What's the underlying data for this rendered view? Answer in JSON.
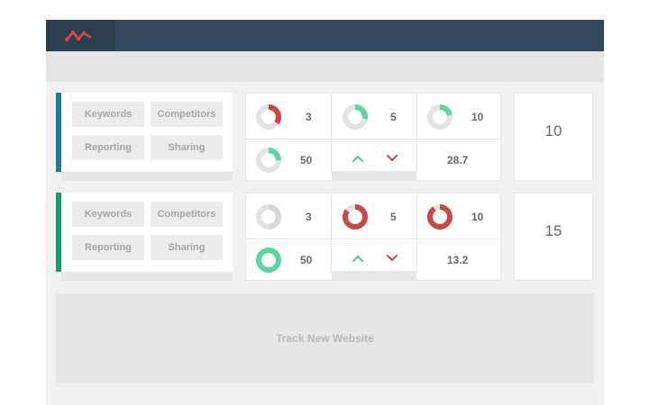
{
  "app": {
    "logo_icon": "trend-line-icon"
  },
  "colors": {
    "topbar": "#34495e",
    "accent_teal": "#1d7e93",
    "accent_green": "#199c6e",
    "donut_red": "#c94a44",
    "donut_green": "#5fd4a0",
    "donut_track": "#e3e3e3"
  },
  "websites": [
    {
      "buttons": [
        "Keywords",
        "Competitors",
        "Reporting",
        "Sharing"
      ],
      "metrics": {
        "m1": {
          "value": "3",
          "color": "#c94a44",
          "fraction": 0.35
        },
        "m2": {
          "value": "5",
          "color": "#5fd4a0",
          "fraction": 0.28
        },
        "m3": {
          "value": "10",
          "color": "#5fd4a0",
          "fraction": 0.22
        },
        "m4": {
          "value": "50",
          "color": "#5fd4a0",
          "fraction": 0.25
        },
        "up_icon": "chevron-up-icon",
        "down_icon": "chevron-down-icon",
        "average": "28.7"
      },
      "total": "10"
    },
    {
      "buttons": [
        "Keywords",
        "Competitors",
        "Reporting",
        "Sharing"
      ],
      "metrics": {
        "m1": {
          "value": "3",
          "color": "#d6d6d6",
          "fraction": 0.5
        },
        "m2": {
          "value": "5",
          "color": "#c94a44",
          "fraction": 0.85
        },
        "m3": {
          "value": "10",
          "color": "#c94a44",
          "fraction": 0.9
        },
        "m4": {
          "value": "50",
          "color": "#5fd4a0",
          "fraction": 1.0
        },
        "up_icon": "chevron-up-icon",
        "down_icon": "chevron-down-icon",
        "average": "13.2"
      },
      "total": "15"
    }
  ],
  "track_new_label": "Track New Website"
}
